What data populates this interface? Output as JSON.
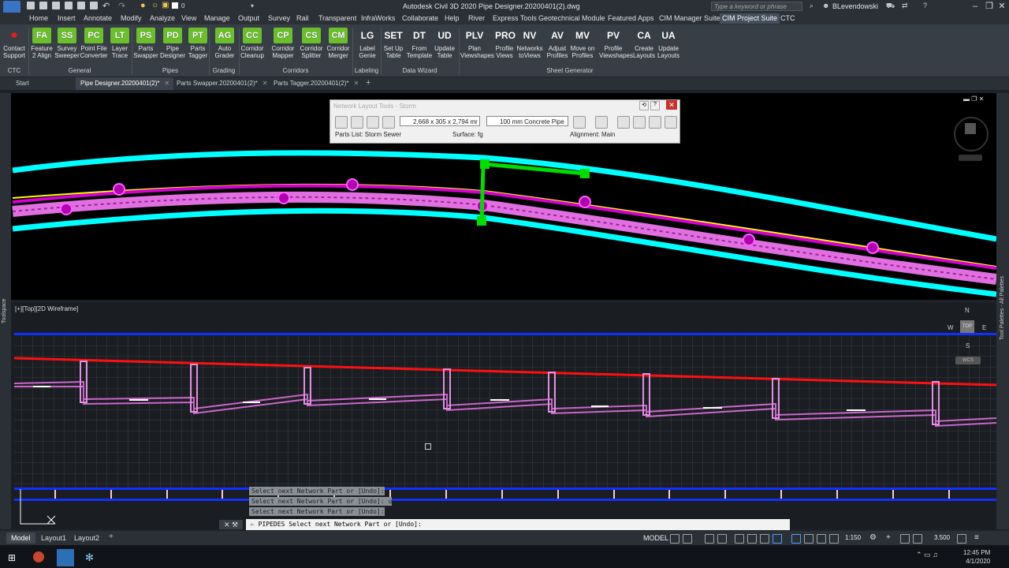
{
  "app": {
    "logo_text": "C3D",
    "title": "Autodesk Civil 3D 2020    Pipe Designer.20200401(2).dwg",
    "qat_layer": "0",
    "search_placeholder": "Type a keyword or phrase",
    "user": "BLevendowski"
  },
  "menu_tabs": [
    "Home",
    "Insert",
    "Annotate",
    "Modify",
    "Analyze",
    "View",
    "Manage",
    "Output",
    "Survey",
    "Rail",
    "Transparent",
    "InfraWorks",
    "Collaborate",
    "Help",
    "River",
    "Express Tools",
    "Geotechnical Module",
    "Featured Apps",
    "CIM Manager Suite",
    "CIM Project Suite",
    "CTC"
  ],
  "active_menu_tab": "CIM Project Suite",
  "ribbon": {
    "buttons": [
      {
        "abbr": "",
        "label": "Contact\nSupport",
        "icon": "contact-support-icon"
      },
      {
        "abbr": "FA",
        "label": "Feature\n2 Align"
      },
      {
        "abbr": "SS",
        "label": "Survey\nSweeper"
      },
      {
        "abbr": "PC",
        "label": "Point File\nConverter"
      },
      {
        "abbr": "LT",
        "label": "Layer\nTrace"
      },
      {
        "abbr": "PS",
        "label": "Parts\nSwapper"
      },
      {
        "abbr": "PD",
        "label": "Pipe\nDesigner"
      },
      {
        "abbr": "PT",
        "label": "Parts\nTagger"
      },
      {
        "abbr": "AG",
        "label": "Auto\nGrader"
      },
      {
        "abbr": "CC",
        "label": "Corridor\nCleanup"
      },
      {
        "abbr": "CP",
        "label": "Corridor\nMapper"
      },
      {
        "abbr": "CS",
        "label": "Corridor\nSplitter"
      },
      {
        "abbr": "CM",
        "label": "Corridor\nMerger"
      },
      {
        "abbr": "LG",
        "label": "Label\nGenie"
      },
      {
        "abbr": "SET",
        "label": "Set Up\nTable"
      },
      {
        "abbr": "DT",
        "label": "From\nTemplate"
      },
      {
        "abbr": "UD",
        "label": "Update\nTable"
      },
      {
        "abbr": "PLV",
        "label": "Plan\nViewshapes"
      },
      {
        "abbr": "PRO",
        "label": "Profile\nViews"
      },
      {
        "abbr": "NV",
        "label": "Networks\ntoViews"
      },
      {
        "abbr": "AV",
        "label": "Adjust\nProfiles"
      },
      {
        "abbr": "MV",
        "label": "Move on\nProfiles"
      },
      {
        "abbr": "PV",
        "label": "Profile\nViewshapes"
      },
      {
        "abbr": "CA",
        "label": "Create\nLayouts"
      },
      {
        "abbr": "UA",
        "label": "Update\nLayouts"
      }
    ],
    "panels": [
      "CTC",
      "General",
      "Pipes",
      "Grading",
      "Corridors",
      "Labeling",
      "Data Wizard",
      "Sheet Generator"
    ]
  },
  "doc_tabs": [
    {
      "label": "Start",
      "closable": false
    },
    {
      "label": "Pipe Designer.20200401(2)*",
      "closable": true
    },
    {
      "label": "Parts Swapper.20200401(2)*",
      "closable": true
    },
    {
      "label": "Parts Tagger.20200401(2)*",
      "closable": true
    }
  ],
  "active_doc_tab": "Pipe Designer.20200401(2)*",
  "network_tool": {
    "title": "Network Layout Tools - Storm",
    "structure_size": "2,668 x 305 x 2,794 mr",
    "pipe": "100 mm Concrete Pipe",
    "parts_list": "Parts List: Storm Sewer",
    "surface": "Surface: fg",
    "alignment": "Alignment: Main"
  },
  "viewport": {
    "label": "[+][Top][2D Wireframe]",
    "compass": {
      "n": "N",
      "s": "S",
      "e": "E",
      "w": "W",
      "top": "TOP",
      "wcs": "WCS"
    }
  },
  "side_palettes": {
    "left": "Toolspace",
    "right": "Tool Palettes - All Palettes"
  },
  "command": {
    "history": [
      "Select next Network Part or [Undo]:",
      "Select next Network Part or [Undo]: u",
      "Select next Network Part or [Undo]:"
    ],
    "current": "PIPEDES Select next Network Part or [Undo]:"
  },
  "status": {
    "layout_tabs": [
      "Model",
      "Layout1",
      "Layout2"
    ],
    "active_layout": "Model",
    "mode": "MODEL",
    "scale": "1:150",
    "elevation": "3.500"
  },
  "taskbar": {
    "time": "12:45 PM",
    "date": "4/1/2020"
  },
  "colors": {
    "surface_edge": "#00ffff",
    "pipe": "#ff00ff",
    "selection": "#00dd00",
    "ground_profile": "#ff0000",
    "profile_frame": "#1030ff",
    "profile_pipe": "#cc66cc",
    "accent_icon": "#6bbf2a"
  }
}
